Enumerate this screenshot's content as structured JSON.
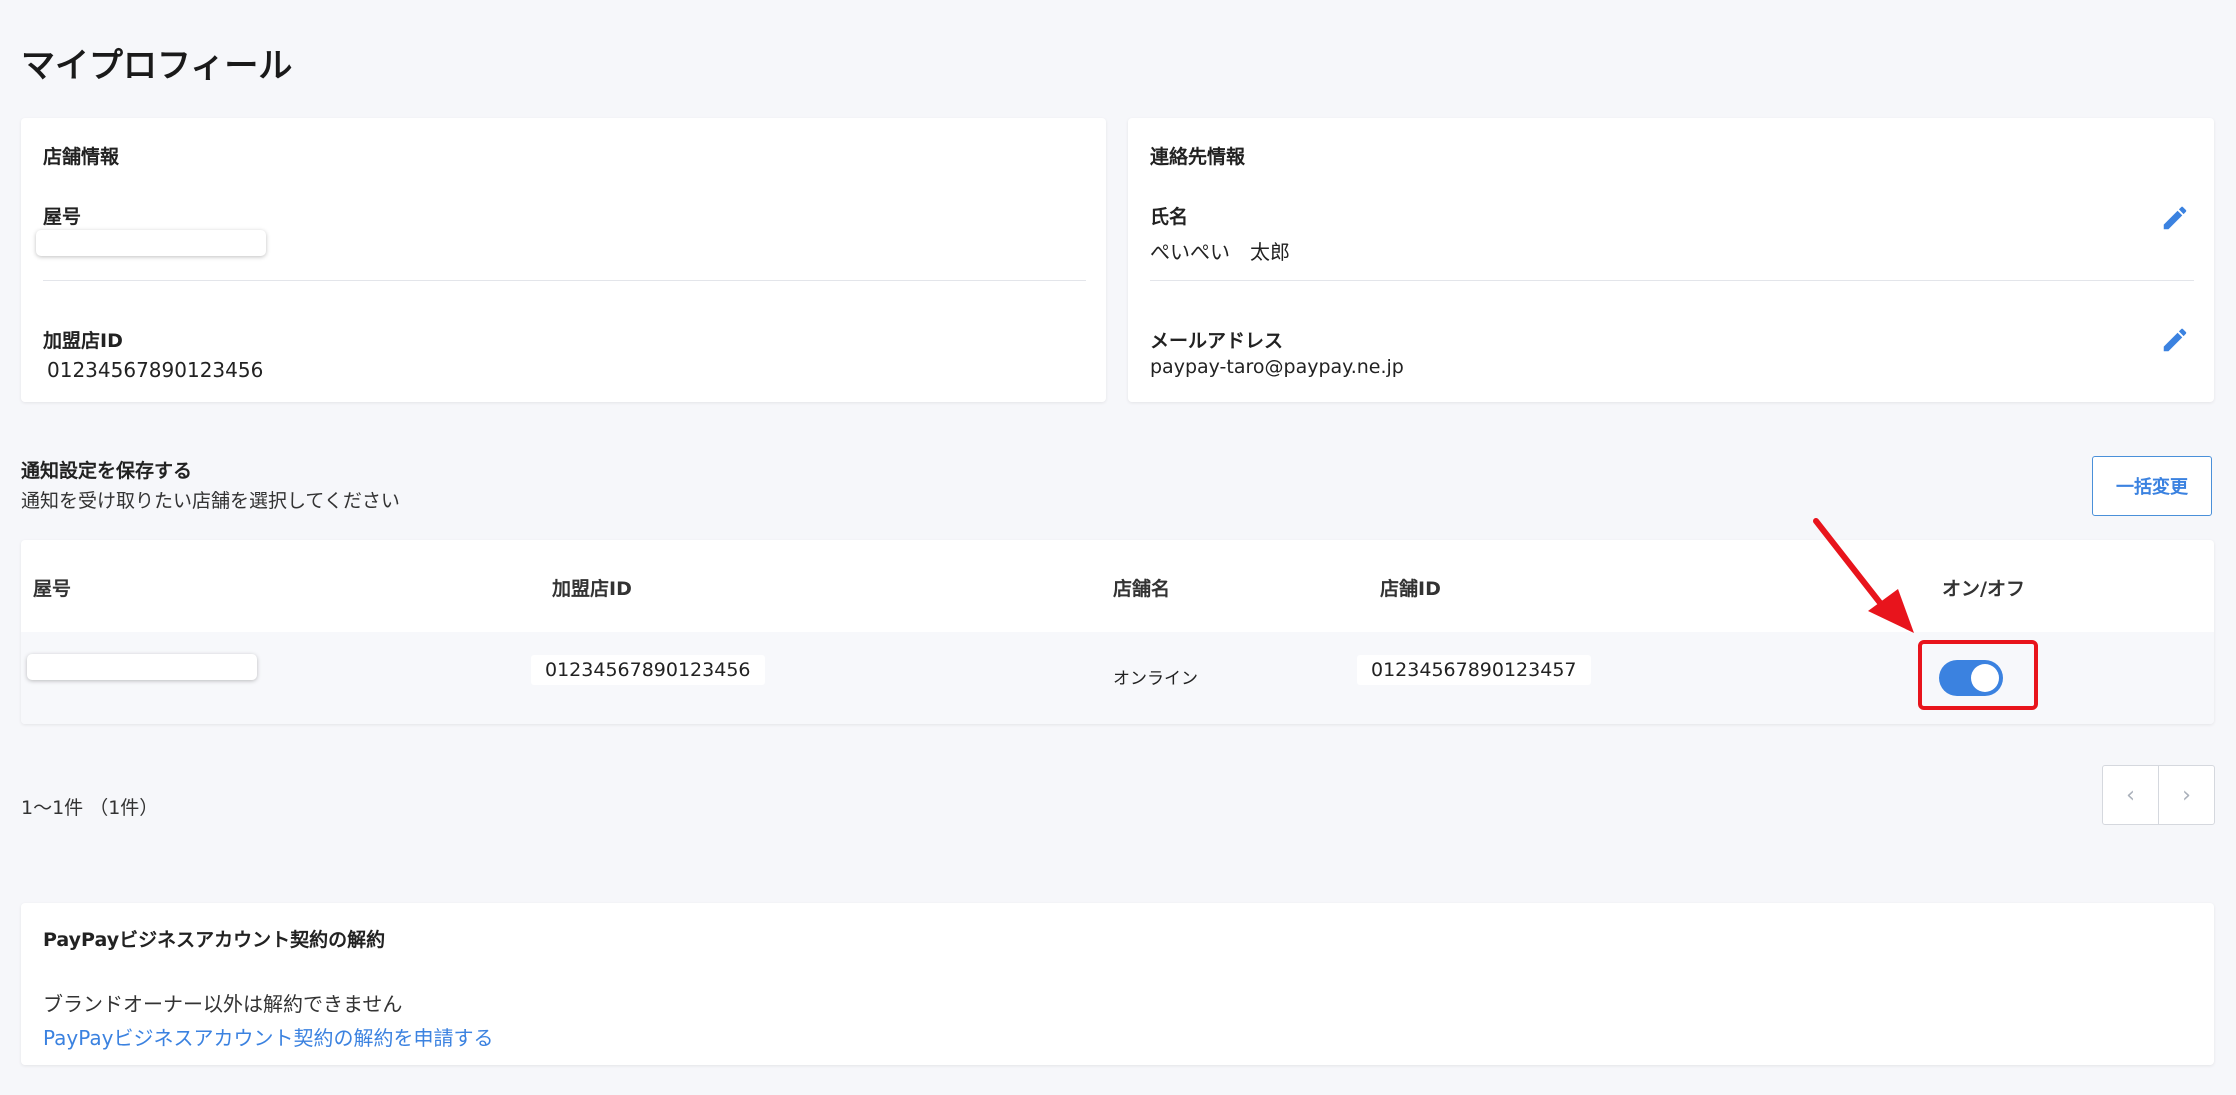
{
  "page": {
    "title": "マイプロフィール"
  },
  "store_info": {
    "title": "店舗情報",
    "shop_name_label": "屋号",
    "merchant_id_label": "加盟店ID",
    "merchant_id_value": "01234567890123456"
  },
  "contact_info": {
    "title": "連絡先情報",
    "name_label": "氏名",
    "name_value": "ぺいぺい　太郎",
    "email_label": "メールアドレス",
    "email_value": "paypay-taro@paypay.ne.jp"
  },
  "notification": {
    "title": "通知設定を保存する",
    "subtitle": "通知を受け取りたい店舗を選択してください",
    "bulk_change_label": "一括変更",
    "columns": [
      "屋号",
      "加盟店ID",
      "店舗名",
      "店舗ID",
      "オン/オフ"
    ],
    "rows": [
      {
        "shop_name": "",
        "merchant_id": "01234567890123456",
        "store_name": "オンライン",
        "store_id": "01234567890123457",
        "enabled": true
      }
    ]
  },
  "pagination": {
    "summary": "1〜1件 （1件）",
    "prev_icon": "‹",
    "next_icon": "›"
  },
  "contract_cancel": {
    "title": "PayPayビジネスアカウント契約の解約",
    "note": "ブランドオーナー以外は解約できません",
    "link_text": "PayPayビジネスアカウント契約の解約を申請する"
  },
  "colors": {
    "accent": "#3b82e0",
    "highlight": "#e8141c",
    "background": "#f6f7fa"
  }
}
